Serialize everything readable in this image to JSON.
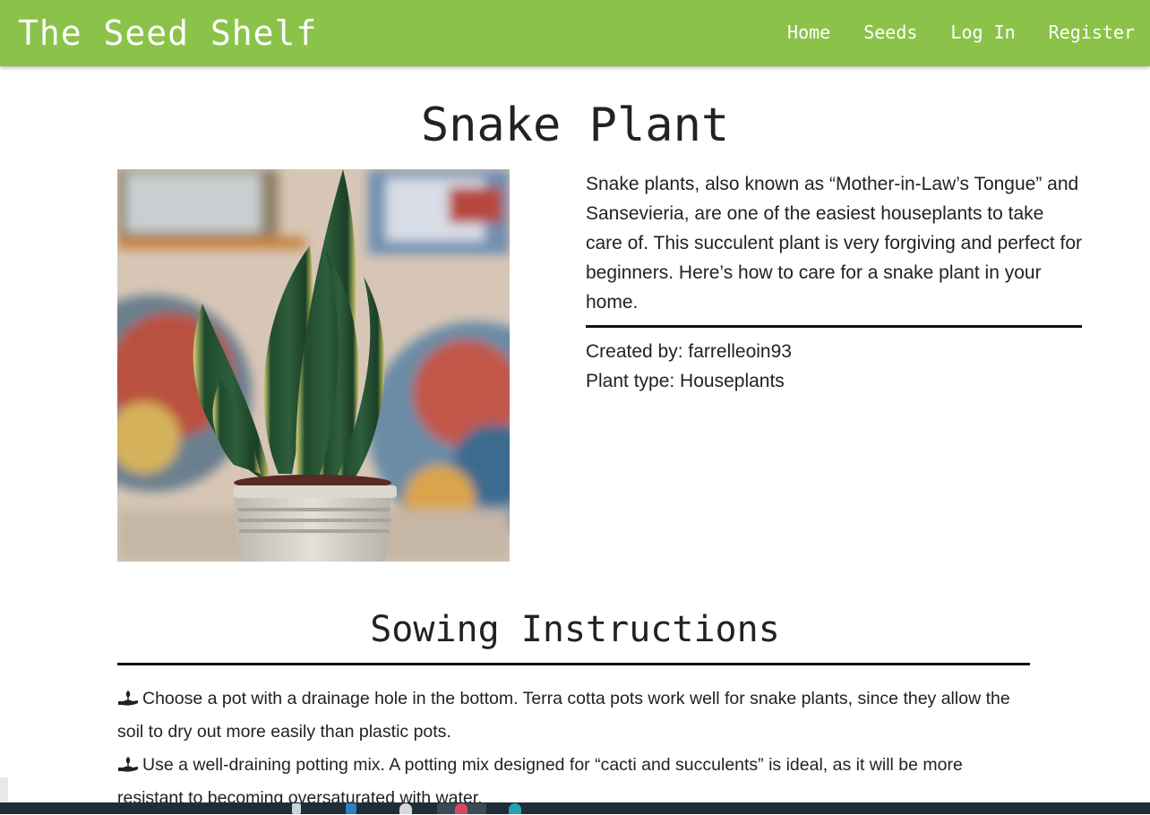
{
  "nav": {
    "brand": "The Seed Shelf",
    "links": [
      "Home",
      "Seeds",
      "Log In",
      "Register"
    ]
  },
  "plant": {
    "title": "Snake Plant",
    "description": "Snake plants, also known as “Mother-in-Law’s Tongue” and Sansevieria, are one of the easiest houseplants to take care of. This succulent plant is very forgiving and perfect for beginners. Here’s how to care for a snake plant in your home.",
    "created_by": "Created by: farrelleoin93",
    "plant_type": "Plant type: Houseplants"
  },
  "sowing": {
    "title": "Sowing Instructions",
    "items": [
      "Choose a pot with a drainage hole in the bottom. Terra cotta pots work well for snake plants, since they allow the soil to dry out more easily than plastic pots.",
      "Use a well-draining potting mix. A potting mix designed for “cacti and succulents” is ideal, as it will be more resistant to becoming oversaturated with water."
    ]
  },
  "icons": {
    "instruction_bullet": "seedling-in-hand-icon"
  },
  "colors": {
    "navbar": "#8bc34a",
    "text": "#222222",
    "divider": "#111111"
  }
}
